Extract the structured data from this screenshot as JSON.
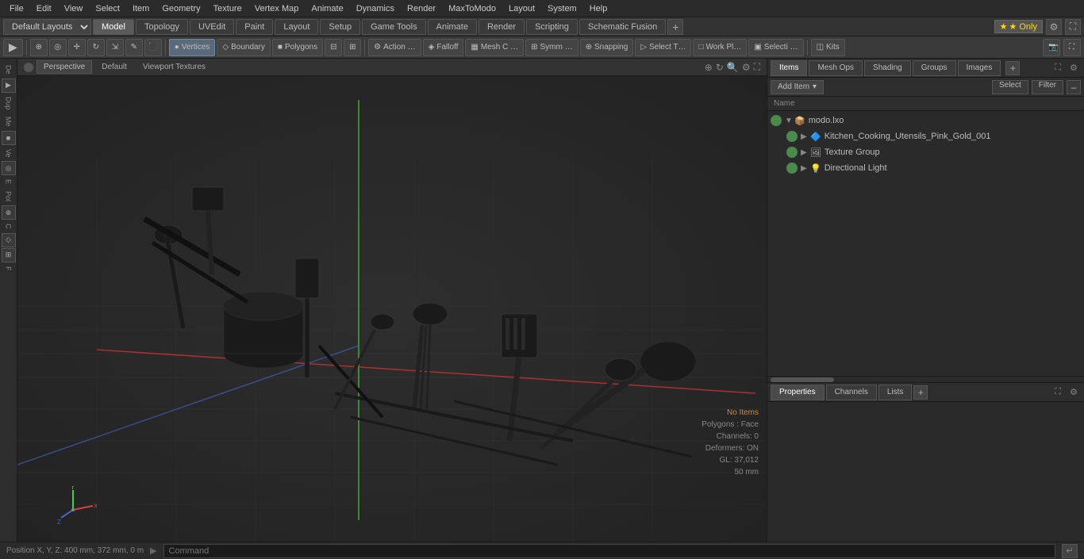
{
  "menubar": {
    "items": [
      "File",
      "Edit",
      "View",
      "Select",
      "Item",
      "Geometry",
      "Texture",
      "Vertex Map",
      "Animate",
      "Dynamics",
      "Render",
      "MaxToModo",
      "Layout",
      "System",
      "Help"
    ]
  },
  "layout_bar": {
    "dropdown": "Default Layouts",
    "tabs": [
      "Model",
      "Topology",
      "UVEdit",
      "Paint",
      "Layout",
      "Setup",
      "Game Tools",
      "Animate",
      "Render",
      "Scripting",
      "Schematic Fusion"
    ],
    "active_tab": "Model",
    "add_label": "+",
    "star_label": "★ Only"
  },
  "toolbar": {
    "buttons": [
      {
        "label": "Vertices",
        "icon": "●"
      },
      {
        "label": "Boundary",
        "icon": "◇"
      },
      {
        "label": "Polygons",
        "icon": "■"
      },
      {
        "label": ""
      },
      {
        "label": "Action …",
        "icon": "⚙"
      },
      {
        "label": "Falloff",
        "icon": "◈"
      },
      {
        "label": "Mesh C …",
        "icon": "▦"
      },
      {
        "label": "Symm …",
        "icon": "⊞"
      },
      {
        "label": "Snapping",
        "icon": "⊕"
      },
      {
        "label": "Select T…",
        "icon": "▷"
      },
      {
        "label": "Work Pl…",
        "icon": "□"
      },
      {
        "label": "Selecti …",
        "icon": "▣"
      },
      {
        "label": "Kits",
        "icon": "◫"
      }
    ]
  },
  "viewport": {
    "header": {
      "perspective": "Perspective",
      "mode": "Default",
      "textures": "Viewport Textures"
    },
    "status": {
      "no_items": "No Items",
      "polygons": "Polygons : Face",
      "channels": "Channels: 0",
      "deformers": "Deformers: ON",
      "gl": "GL: 37,012",
      "unit": "50 mm"
    }
  },
  "items_panel": {
    "tabs": [
      "Items",
      "Mesh Ops",
      "Shading",
      "Groups",
      "Images"
    ],
    "active_tab": "Items",
    "add_item_label": "Add Item",
    "select_label": "Select",
    "filter_label": "Filter",
    "col_name": "Name",
    "tree": [
      {
        "id": 1,
        "level": 0,
        "icon": "📦",
        "label": "modo.lxo",
        "expanded": true,
        "visible": true,
        "type": "root"
      },
      {
        "id": 2,
        "level": 1,
        "icon": "🔷",
        "label": "Kitchen_Cooking_Utensils_Pink_Gold_001",
        "expanded": false,
        "visible": true,
        "type": "mesh"
      },
      {
        "id": 3,
        "level": 1,
        "icon": "🖼",
        "label": "Texture Group",
        "expanded": false,
        "visible": true,
        "type": "group"
      },
      {
        "id": 4,
        "level": 1,
        "icon": "💡",
        "label": "Directional Light",
        "expanded": false,
        "visible": true,
        "type": "light"
      }
    ]
  },
  "properties_panel": {
    "tabs": [
      "Properties",
      "Channels",
      "Lists"
    ],
    "active_tab": "Properties"
  },
  "status_bar": {
    "position": "Position X, Y, Z:  400 mm, 372 mm, 0 m",
    "command_placeholder": "Command"
  },
  "colors": {
    "bg_dark": "#2b2b2b",
    "bg_mid": "#333",
    "bg_light": "#3a3a3a",
    "accent_blue": "#3a5070",
    "border": "#555",
    "text": "#ccc",
    "text_dim": "#888",
    "status_warn": "#cc8844",
    "axis_x": "#cc3333",
    "axis_y": "#44cc44",
    "axis_z": "#3366cc",
    "grid": "#404040"
  }
}
